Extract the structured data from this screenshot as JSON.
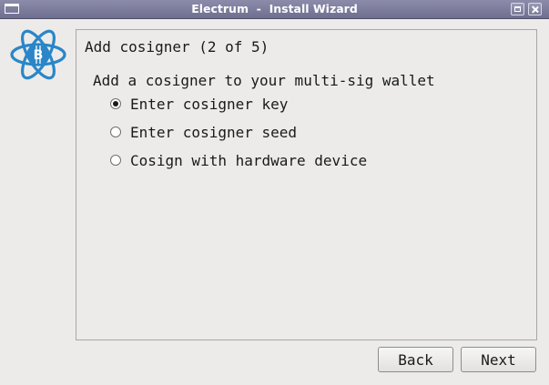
{
  "window": {
    "title": "Electrum  -  Install Wizard",
    "logo_icon": "electrum-logo",
    "accent_color": "#2a86c8"
  },
  "wizard": {
    "step_title": "Add cosigner (2 of 5)",
    "question": "Add a cosigner to your multi-sig wallet",
    "options": [
      {
        "label": "Enter cosigner key",
        "selected": true
      },
      {
        "label": "Enter cosigner seed",
        "selected": false
      },
      {
        "label": "Cosign with hardware device",
        "selected": false
      }
    ]
  },
  "buttons": {
    "back": "Back",
    "next": "Next"
  }
}
